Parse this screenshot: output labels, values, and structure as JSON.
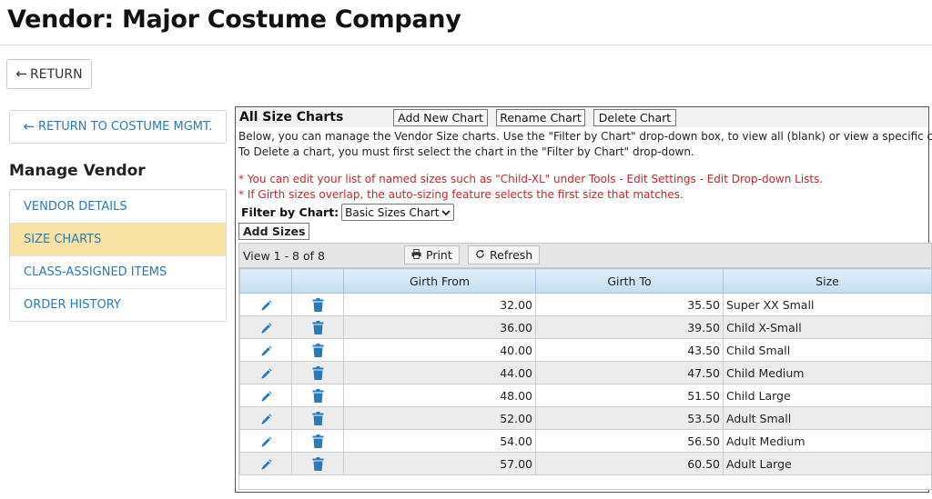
{
  "page": {
    "title": "Vendor: Major Costume Company"
  },
  "return_button": {
    "label": "RETURN",
    "icon": "arrow-left-icon"
  },
  "back_button": {
    "label": "RETURN TO COSTUME MGMT.",
    "icon": "arrow-left-icon"
  },
  "sidebar": {
    "heading": "Manage Vendor",
    "items": [
      {
        "label": "VENDOR DETAILS",
        "active": false
      },
      {
        "label": "SIZE CHARTS",
        "active": true
      },
      {
        "label": "CLASS-ASSIGNED ITEMS",
        "active": false
      },
      {
        "label": "ORDER HISTORY",
        "active": false
      }
    ]
  },
  "panel": {
    "title": "All Size Charts",
    "buttons": {
      "add": "Add New Chart",
      "rename": "Rename Chart",
      "delete": "Delete Chart"
    },
    "description_line1": "Below, you can manage the Vendor Size charts. Use the \"Filter by Chart\" drop-down box, to view all (blank) or view a specific chart.",
    "description_line2": "To Delete a chart, you must first select the chart in the \"Filter by Chart\" drop-down.",
    "note1": "* You can edit your list of named sizes such as \"Child-XL\" under Tools - Edit Settings - Edit Drop-down Lists.",
    "note2": "* If Girth sizes overlap, the auto-sizing feature selects the first size that matches.",
    "filter_label": "Filter by Chart:",
    "filter_value": "Basic Sizes Chart",
    "add_sizes_label": "Add Sizes"
  },
  "grid": {
    "view_info": "View 1 - 8 of 8",
    "print_label": "Print",
    "refresh_label": "Refresh",
    "columns": [
      "Girth From",
      "Girth To",
      "Size"
    ],
    "rows": [
      {
        "from": "32.00",
        "to": "35.50",
        "size": "Super XX Small"
      },
      {
        "from": "36.00",
        "to": "39.50",
        "size": "Child X-Small"
      },
      {
        "from": "40.00",
        "to": "43.50",
        "size": "Child Small"
      },
      {
        "from": "44.00",
        "to": "47.50",
        "size": "Child Medium"
      },
      {
        "from": "48.00",
        "to": "51.50",
        "size": "Child Large"
      },
      {
        "from": "52.00",
        "to": "53.50",
        "size": "Adult Small"
      },
      {
        "from": "54.00",
        "to": "56.50",
        "size": "Adult Medium"
      },
      {
        "from": "57.00",
        "to": "60.50",
        "size": "Adult Large"
      }
    ]
  },
  "colors": {
    "link": "#2a7ab8",
    "active_nav": "#f8e3a4",
    "warning": "#c0282d",
    "icon_blue": "#2a7ab8"
  }
}
